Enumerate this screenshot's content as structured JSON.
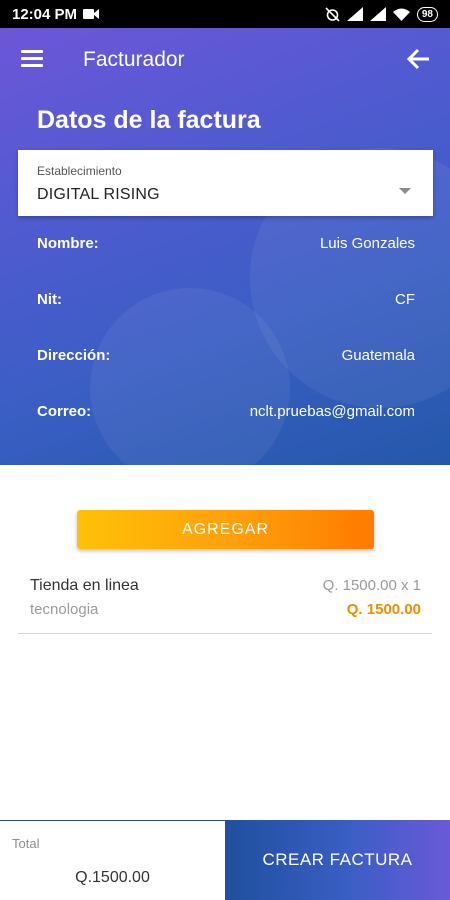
{
  "status_bar": {
    "time": "12:04 PM",
    "battery": "98"
  },
  "header": {
    "title": "Facturador"
  },
  "form": {
    "section_title": "Datos de la factura",
    "establishment": {
      "label": "Establecimiento",
      "value": "DIGITAL RISING"
    },
    "fields": [
      {
        "label": "Nombre:",
        "value": "Luis Gonzales"
      },
      {
        "label": "Nit:",
        "value": "CF"
      },
      {
        "label": "Dirección:",
        "value": "Guatemala"
      },
      {
        "label": "Correo:",
        "value": "nclt.pruebas@gmail.com"
      }
    ]
  },
  "actions": {
    "add_label": "AGREGAR"
  },
  "items": [
    {
      "name": "Tienda en linea",
      "category": "tecnologia",
      "qty_text": "Q. 1500.00 x 1",
      "total": "Q. 1500.00"
    }
  ],
  "footer": {
    "total_label": "Total",
    "total_value": "Q.1500.00",
    "create_label": "CREAR FACTURA"
  },
  "colors": {
    "accent_orange": "#f08c00",
    "primary_blue": "#3a5ec4",
    "primary_purple": "#6d56d9"
  }
}
